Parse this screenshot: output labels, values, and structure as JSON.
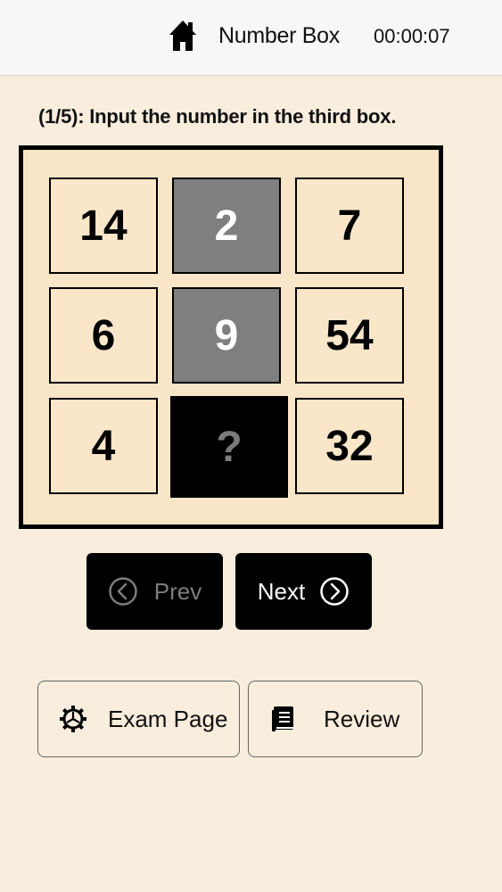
{
  "header": {
    "home_icon": "home-icon",
    "title": "Number Box",
    "timer": "00:00:07"
  },
  "question": {
    "text": "(1/5): Input the number in the third box."
  },
  "grid": {
    "rows": [
      [
        "14",
        "2",
        "7"
      ],
      [
        "6",
        "9",
        "54"
      ],
      [
        "4",
        "?",
        "32"
      ]
    ],
    "colors": {
      "board_border": "#000000",
      "cell_bg": "#fae6c9",
      "highlight_bg": "#7f7f7f",
      "input_bg": "#000000"
    }
  },
  "nav": {
    "prev_label": "Prev",
    "prev_icon": "chevron-left-circle-icon",
    "next_label": "Next",
    "next_icon": "chevron-right-circle-icon"
  },
  "actions": {
    "exam_label": "Exam Page",
    "exam_icon": "gear-icon",
    "review_label": "Review",
    "review_icon": "book-icon"
  }
}
